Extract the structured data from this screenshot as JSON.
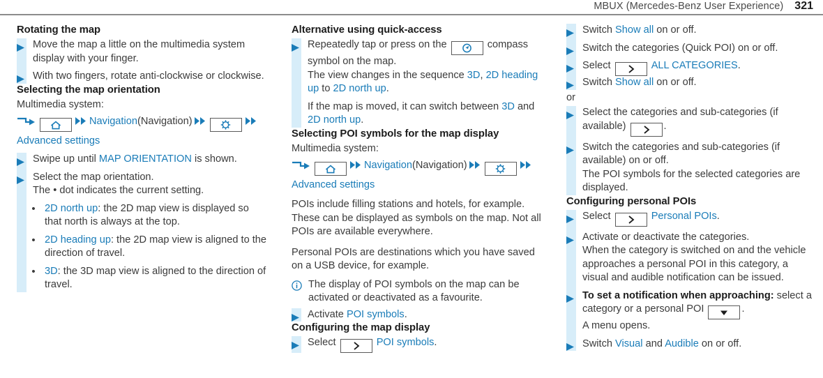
{
  "header": {
    "title": "MBUX (Mercedes-Benz User Experience)",
    "page_number": "321"
  },
  "colors": {
    "link_blue": "#1a7cb8",
    "accent_bar": "#d7edf9",
    "body_text": "#3b3b3b",
    "heading_text": "#1c1c1c",
    "rule_gray": "#8c8c8c"
  },
  "column1": {
    "heading1": "Rotating the map",
    "step1": "Move the map a little on the multimedia system display with your finger.",
    "step2": "With two fingers, rotate anti-clockwise or clockwise.",
    "heading2": "Selecting the map orientation",
    "multimedia_label": "Multimedia system:",
    "path": {
      "arrow_icon": "bent-arrow-icon",
      "home_icon": "home-icon",
      "chevron_icon": "double-chevron-icon",
      "nav_label": "Navigation",
      "nav_paren": "(Navigation)",
      "gear_icon": "gear-icon",
      "advanced_label": "Advanced settings"
    },
    "step3_pre": "Swipe up until ",
    "step3_blue": "MAP ORIENTATION",
    "step3_post": " is shown.",
    "step4": "Select the map orientation.",
    "step4_note": "The • dot indicates the current setting.",
    "bullets": [
      {
        "term": "2D north up",
        "desc": ": the 2D map view is displayed so that north is always at the top."
      },
      {
        "term": "2D heading up",
        "desc": ": the 2D map view is aligned to the direction of travel."
      },
      {
        "term": "3D",
        "desc": ": the 3D map view is aligned to the direction of travel."
      }
    ]
  },
  "column2": {
    "heading1": "Alternative using quick-access",
    "step1_pre": "Repeatedly tap or press on the ",
    "step1_icon": "compass-icon",
    "step1_post": " compass symbol on the map.",
    "step1_line2_pre": "The view changes in the sequence ",
    "step1_line2_b1": "3D",
    "step1_line2_mid1": ", ",
    "step1_line2_b2": "2D heading up",
    "step1_line2_mid2": " to ",
    "step1_line2_b3": "2D north up",
    "step1_line2_end": ".",
    "step1_line3_pre": "If the map is moved, it can switch between ",
    "step1_line3_b1": "3D",
    "step1_line3_mid": " and ",
    "step1_line3_b2": "2D north up",
    "step1_line3_end": ".",
    "heading2": "Selecting POI symbols for the map display",
    "multimedia_label": "Multimedia system:",
    "path": {
      "arrow_icon": "bent-arrow-icon",
      "home_icon": "home-icon",
      "chevron_icon": "double-chevron-icon",
      "nav_label": "Navigation",
      "nav_paren": "(Navigation)",
      "gear_icon": "gear-icon",
      "advanced_label": "Advanced settings"
    },
    "para1": "POIs include filling stations and hotels, for example. These can be displayed as symbols on the map. Not all POIs are available everywhere.",
    "para2": "Personal POIs are destinations which you have saved on a USB device, for example.",
    "note": "The display of POI symbols on the map can be activated or deactivated as a favourite.",
    "note_icon": "info-icon",
    "step2_pre": "Activate ",
    "step2_blue": "POI symbols",
    "step2_post": ".",
    "heading3": "Configuring the map display",
    "step3_pre": "Select ",
    "step3_icon": "chevron-right-box-icon",
    "step3_blue": "POI symbols",
    "step3_post": "."
  },
  "column3": {
    "step1_pre": "Switch ",
    "step1_blue": "Show all",
    "step1_post": " on or off.",
    "step2": "Switch the categories (Quick POI) on or off.",
    "step3_pre": "Select ",
    "step3_icon": "chevron-right-box-icon",
    "step3_blue": "ALL CATEGORIES",
    "step3_post": ".",
    "step4_pre": "Switch ",
    "step4_blue": "Show all",
    "step4_post": " on or off.",
    "or_label": "or",
    "step5_pre": "Select the categories and sub-categories (if available) ",
    "step5_icon": "chevron-right-box-icon",
    "step5_post": ".",
    "step6": "Switch the categories and sub-categories (if available) on or off.",
    "step6_note": "The POI symbols for the selected categories are displayed.",
    "heading1": "Configuring personal POIs",
    "step7_pre": "Select ",
    "step7_icon": "chevron-right-box-icon",
    "step7_blue": "Personal POIs",
    "step7_post": ".",
    "step8": "Activate or deactivate the categories.",
    "step8_note": "When the category is switched on and the vehicle approaches a personal POI in this category, a visual and audible notification can be issued.",
    "step9_bold": "To set a notification when approaching:",
    "step9_pre": " select a category or a personal POI ",
    "step9_icon": "triangle-down-box-icon",
    "step9_post": ".",
    "step9_note": "A menu opens.",
    "step10_pre": "Switch ",
    "step10_b1": "Visual",
    "step10_mid": " and ",
    "step10_b2": "Audible",
    "step10_post": " on or off."
  }
}
